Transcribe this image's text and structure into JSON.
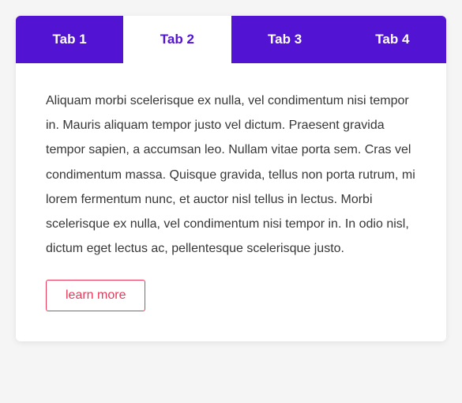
{
  "tabs": [
    {
      "label": "Tab 1",
      "active": false
    },
    {
      "label": "Tab 2",
      "active": true
    },
    {
      "label": "Tab 3",
      "active": false
    },
    {
      "label": "Tab 4",
      "active": false
    }
  ],
  "panel": {
    "body": "Aliquam morbi scelerisque ex nulla, vel condimentum nisi tempor in. Mauris aliquam tempor justo vel dictum. Praesent gravida tempor sapien, a accumsan leo. Nullam vitae porta sem. Cras vel condimentum massa. Quisque gravida, tellus non porta rutrum, mi lorem fermentum nunc, et auctor nisl tellus in lectus. Morbi scelerisque ex nulla, vel condimentum nisi tempor in. In odio nisl, dictum eget lectus ac, pellentesque scelerisque justo.",
    "cta_label": "learn more"
  }
}
